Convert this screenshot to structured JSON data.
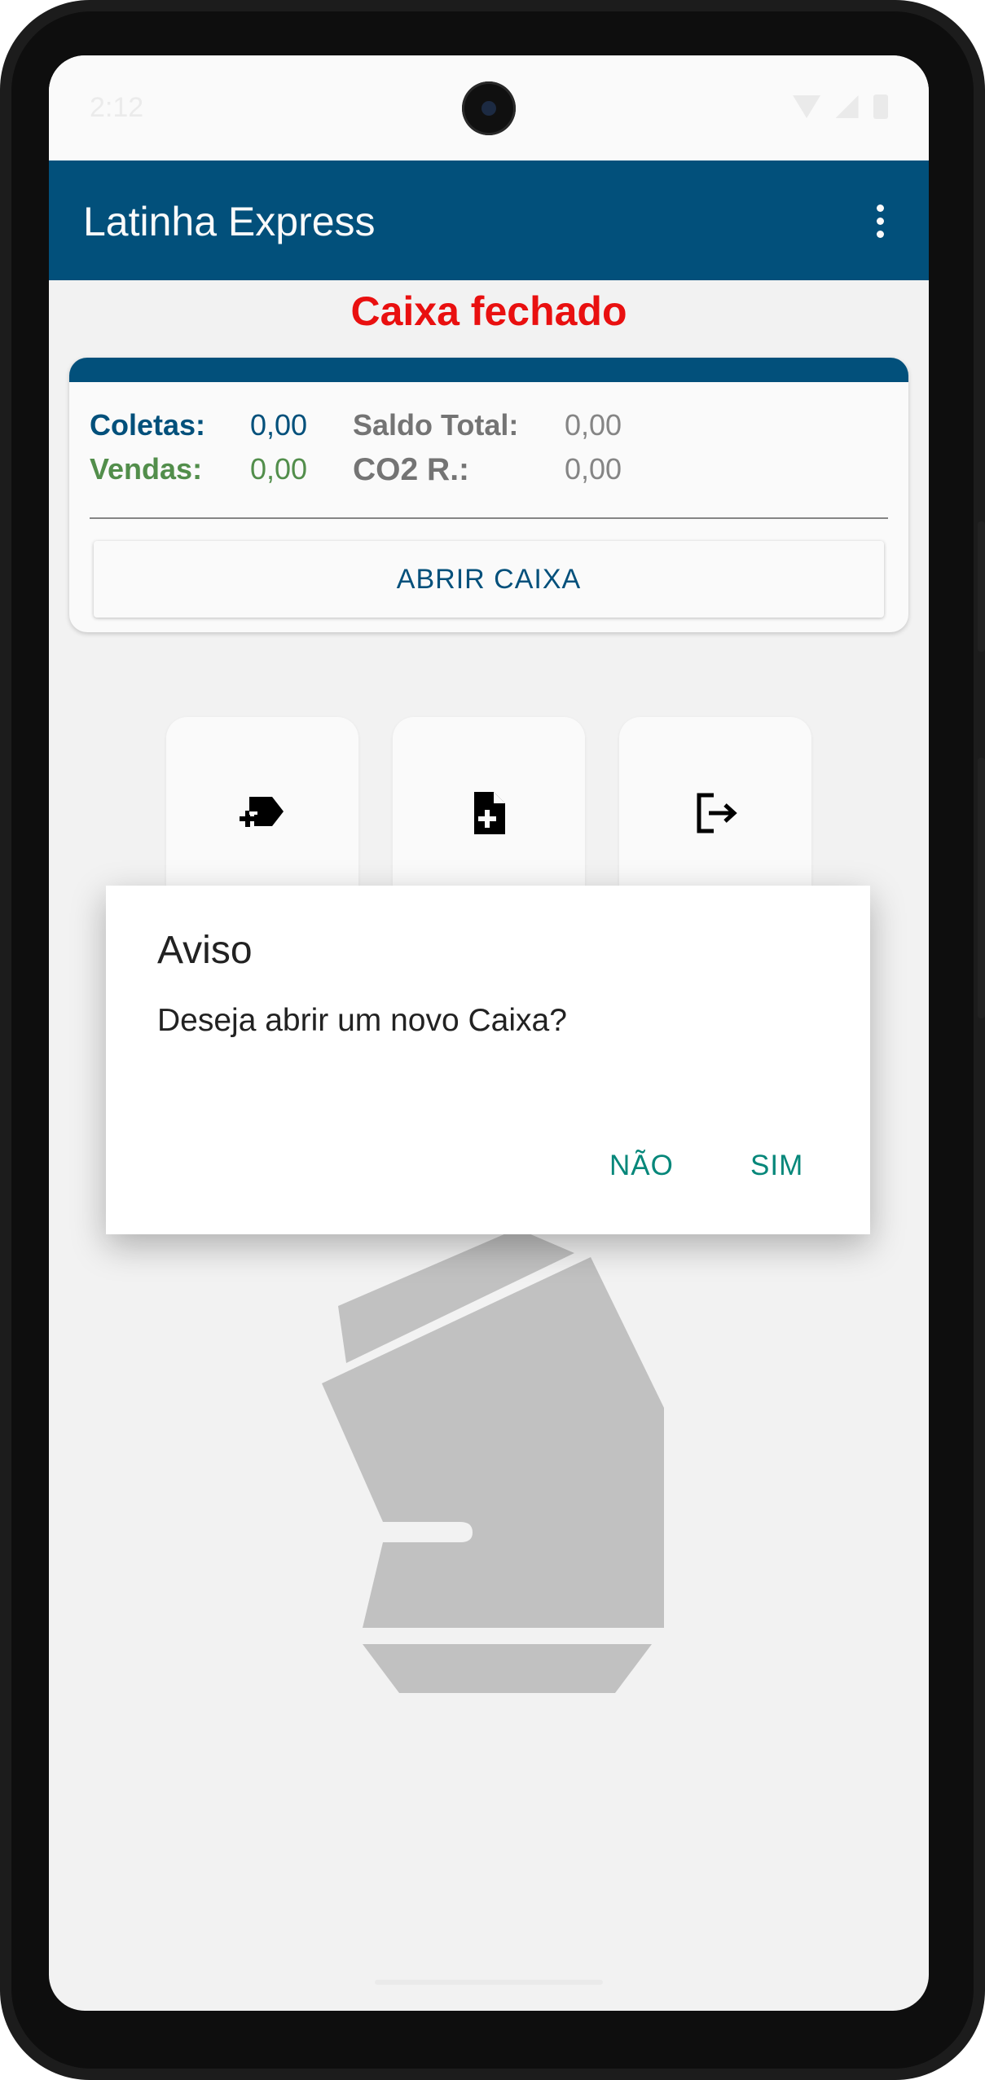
{
  "status_bar": {
    "time": "2:12"
  },
  "app_bar": {
    "title": "Latinha Express",
    "menu_icon": "more-vert-icon"
  },
  "caixa_status": "Caixa fechado",
  "summary": {
    "coletas_label": "Coletas:",
    "coletas_value": "0,00",
    "vendas_label": "Vendas:",
    "vendas_value": "0,00",
    "saldo_label": "Saldo Total:",
    "saldo_value": "0,00",
    "co2_label": "CO2 R.:",
    "co2_value": "0,00",
    "open_button": "ABRIR CAIXA"
  },
  "actions": [
    {
      "icon": "add-label-icon"
    },
    {
      "icon": "add-document-icon"
    },
    {
      "icon": "logout-icon"
    }
  ],
  "dialog": {
    "title": "Aviso",
    "message": "Deseja abrir um novo Caixa?",
    "cancel_label": "NÃO",
    "confirm_label": "SIM"
  },
  "colors": {
    "primary": "#03527e",
    "status_closed": "#ee1111",
    "vendas": "#54914d",
    "dialog_button": "#06877a"
  }
}
